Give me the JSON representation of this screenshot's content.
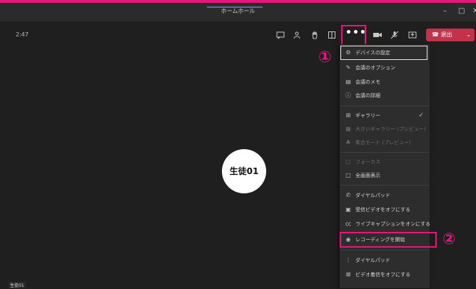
{
  "window": {
    "title": "ホームホール",
    "minimize": "–",
    "maximize": "□",
    "close": "✕"
  },
  "toolbar": {
    "timer": "2:47",
    "more_label": "•••",
    "leave_label": "退出",
    "leave_icon": "phone-hangup-icon",
    "icons": [
      "chat-icon",
      "participants-icon",
      "raise-hand-icon",
      "breakout-icon",
      "camera-icon",
      "mic-icon",
      "share-icon"
    ]
  },
  "participant": {
    "name": "生徒01"
  },
  "bottom_label": "生徒01",
  "menu": {
    "items": [
      {
        "label": "デバイスの設定",
        "icon": "gear-icon"
      },
      {
        "label": "会議のオプション",
        "icon": "options-icon"
      },
      {
        "label": "会議のメモ",
        "icon": "notes-icon"
      },
      {
        "label": "会議の詳細",
        "icon": "info-icon"
      },
      {
        "label": "ギャラリー",
        "icon": "gallery-icon",
        "checked": true
      },
      {
        "label": "大きいギャラリー (プレビュー)",
        "icon": "large-gallery-icon",
        "disabled": true
      },
      {
        "label": "集合モード (プレビュー)",
        "icon": "together-mode-icon",
        "disabled": true
      },
      {
        "label": "フォーカス",
        "icon": "focus-icon",
        "disabled": true
      },
      {
        "label": "全画面表示",
        "icon": "fullscreen-icon"
      },
      {
        "label": "ダイヤルパッド",
        "icon": "dialpad-icon"
      },
      {
        "label": "受信ビデオをオフにする",
        "icon": "video-off-icon"
      },
      {
        "label": "ライブキャプションをオンにする",
        "icon": "captions-icon"
      },
      {
        "label": "レコーディングを開始",
        "icon": "record-icon"
      },
      {
        "label": "ダイヤルパッド",
        "icon": "dialpad-icon"
      },
      {
        "label": "ビデオ着信をオフにする",
        "icon": "video-incoming-off-icon"
      }
    ]
  },
  "annotations": {
    "step1": "①",
    "step2": "②"
  },
  "colors": {
    "highlight": "#e3177e",
    "leave_button": "#c4314b",
    "background": "#1f1f1f",
    "menu_background": "#2d2d2d"
  }
}
